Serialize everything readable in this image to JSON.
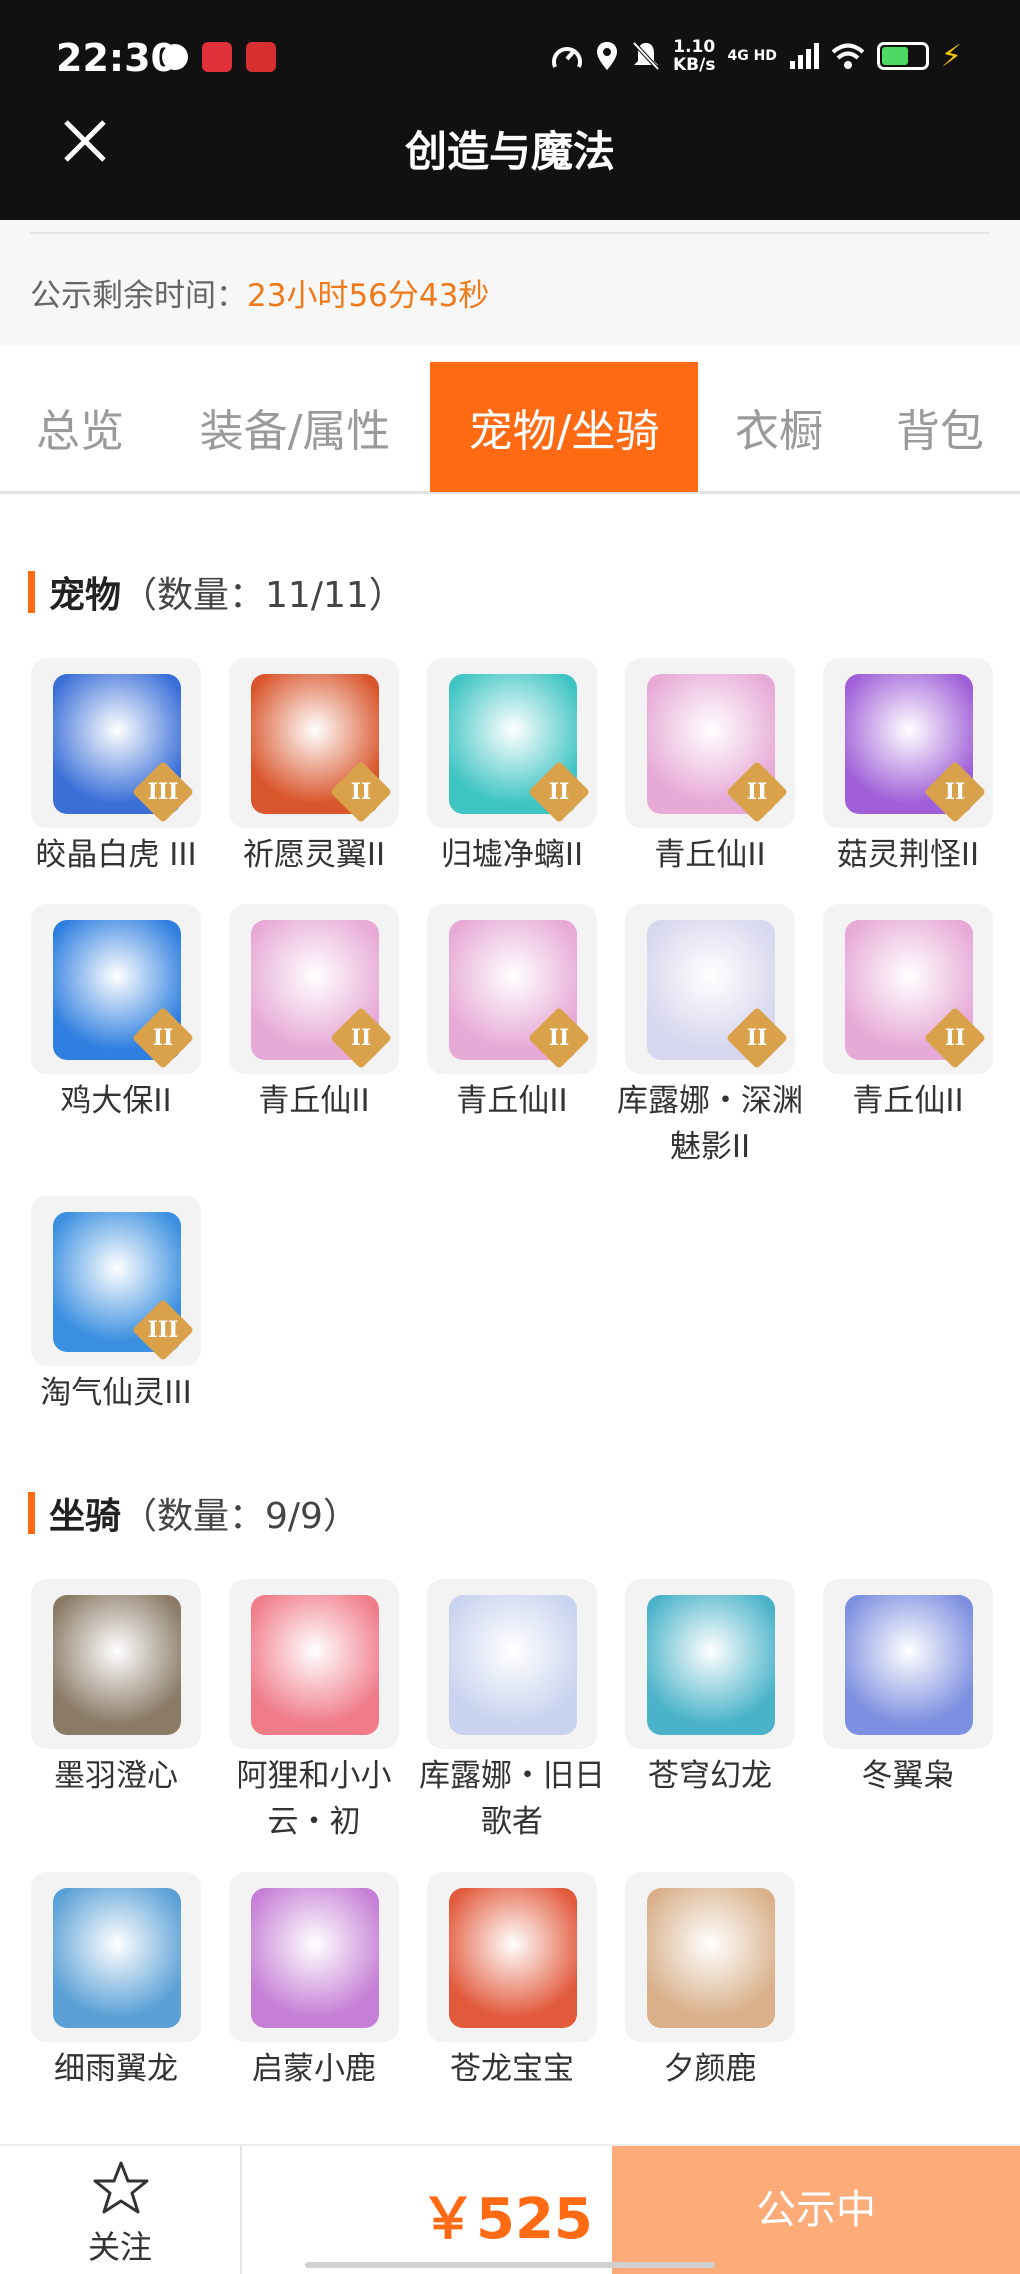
{
  "status_bar": {
    "time": "22:30",
    "net_speed": "1.10",
    "net_unit": "KB/s",
    "network_type": "4G HD"
  },
  "header": {
    "title": "创造与魔法",
    "close_icon": "close-icon"
  },
  "notice": {
    "label": "公示剩余时间：",
    "remaining": "23小时56分43秒"
  },
  "tabs": [
    {
      "label": "总览",
      "active": false
    },
    {
      "label": "装备/属性",
      "active": false
    },
    {
      "label": "宠物/坐骑",
      "active": true
    },
    {
      "label": "衣橱",
      "active": false
    },
    {
      "label": "背包",
      "active": false
    }
  ],
  "pets": {
    "title": "宠物",
    "count": "（数量：11/11）",
    "items": [
      {
        "name": "皎晶白虎 III",
        "grade": "III",
        "color": "#3a6fd8"
      },
      {
        "name": "祈愿灵翼II",
        "grade": "II",
        "color": "#d9552b"
      },
      {
        "name": "归墟净螭II",
        "grade": "II",
        "color": "#3fc4c4"
      },
      {
        "name": "青丘仙II",
        "grade": "II",
        "color": "#e7a9d6"
      },
      {
        "name": "菇灵荆怪II",
        "grade": "II",
        "color": "#a05fd8"
      },
      {
        "name": "鸡大保II",
        "grade": "II",
        "color": "#2f7fe0"
      },
      {
        "name": "青丘仙II",
        "grade": "II",
        "color": "#e7a9d6"
      },
      {
        "name": "青丘仙II",
        "grade": "II",
        "color": "#e7a9d6"
      },
      {
        "name": "库露娜・深渊魅影II",
        "grade": "II",
        "color": "#d6d6ee"
      },
      {
        "name": "青丘仙II",
        "grade": "II",
        "color": "#e7a9d6"
      },
      {
        "name": "淘气仙灵III",
        "grade": "III",
        "color": "#3a8fe0"
      }
    ]
  },
  "mounts": {
    "title": "坐骑",
    "count": "（数量：9/9）",
    "items": [
      {
        "name": "墨羽澄心",
        "color": "#8a7a66"
      },
      {
        "name": "阿狸和小小云・初",
        "color": "#f07c8a"
      },
      {
        "name": "库露娜・旧日歌者",
        "color": "#c9d3ef"
      },
      {
        "name": "苍穹幻龙",
        "color": "#4ab3c9"
      },
      {
        "name": "冬翼枭",
        "color": "#7d8fe0"
      },
      {
        "name": "细雨翼龙",
        "color": "#5aa0d6"
      },
      {
        "name": "启蒙小鹿",
        "color": "#c67fd6"
      },
      {
        "name": "苍龙宝宝",
        "color": "#e25a3c"
      },
      {
        "name": "夕颜鹿",
        "color": "#d9b08a"
      }
    ]
  },
  "bottom_bar": {
    "follow_label": "关注",
    "price": "￥525",
    "status_label": "公示中"
  },
  "colors": {
    "accent": "#ff6a13",
    "status_button": "#fdab78"
  }
}
